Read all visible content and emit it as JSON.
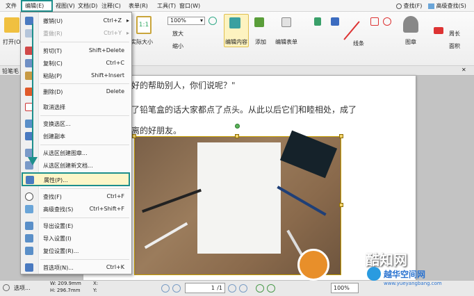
{
  "menubar": {
    "items": [
      "文件",
      "编辑(E)",
      "视图(V)",
      "文档(D)",
      "注释(C)",
      "表单(R)",
      "工具(T)",
      "窗口(W)"
    ],
    "right_find": "查找(F)",
    "right_adv_find": "高级查找(S)"
  },
  "ribbon": {
    "open": "打开(O)",
    "zoom": "100%",
    "actual_size": "实际大小",
    "zoom_in": "放大",
    "zoom_out": "缩小",
    "edit_content": "编辑内容",
    "add": "添加",
    "edit_form": "编辑表单",
    "lines": "线条",
    "stamp": "图章",
    "perimeter": "周长",
    "area": "面积",
    "subbar_left": "铅笔毛"
  },
  "doc": {
    "line1": "好的帮助别人，你们说呢？\"",
    "line2": "了铅笔盒的话大家都点了点头。从此以后它们和睦相处，成了",
    "line3": "离的好朋友。"
  },
  "edit_menu": {
    "items": [
      {
        "label": "撤销(U)",
        "shortcut": "Ctrl+Z",
        "arrow": "▸",
        "disabled": false,
        "icon": "undo-icon"
      },
      {
        "label": "重做(R)",
        "shortcut": "Ctrl+Y",
        "arrow": "▸",
        "disabled": true,
        "icon": "redo-icon"
      },
      {
        "label": "剪切(T)",
        "shortcut": "Shift+Delete",
        "disabled": false,
        "icon": "scissors-icon"
      },
      {
        "label": "复制(C)",
        "shortcut": "Ctrl+C",
        "disabled": false,
        "icon": "copy-icon"
      },
      {
        "label": "粘贴(P)",
        "shortcut": "Shift+Insert",
        "disabled": false,
        "icon": "paste-icon"
      },
      {
        "label": "删除(D)",
        "shortcut": "Delete",
        "disabled": false,
        "icon": "trash-icon"
      },
      {
        "label": "取消选择",
        "shortcut": "",
        "disabled": false,
        "icon": "deselect-icon"
      },
      {
        "label": "变换选区...",
        "shortcut": "",
        "disabled": false,
        "icon": "transform-icon"
      },
      {
        "label": "创建副本",
        "shortcut": "",
        "disabled": false,
        "icon": "duplicate-icon"
      },
      {
        "label": "从选区创建图章...",
        "shortcut": "",
        "disabled": false,
        "icon": "stamp-icon"
      },
      {
        "label": "从选区创建新文档...",
        "shortcut": "",
        "disabled": false,
        "icon": "new-doc-icon"
      },
      {
        "label": "属性(P)...",
        "shortcut": "",
        "disabled": false,
        "icon": "properties-icon"
      },
      {
        "label": "查找(F)",
        "shortcut": "Ctrl+F",
        "disabled": false,
        "icon": "find-icon"
      },
      {
        "label": "高级查找(S)",
        "shortcut": "Ctrl+Shift+F",
        "disabled": false,
        "icon": "advanced-find-icon"
      },
      {
        "label": "导出设置(E)",
        "shortcut": "",
        "disabled": false,
        "icon": "export-settings-icon"
      },
      {
        "label": "导入设置(I)",
        "shortcut": "",
        "disabled": false,
        "icon": "import-settings-icon"
      },
      {
        "label": "复位设置(R)...",
        "shortcut": "",
        "disabled": false,
        "icon": "reset-settings-icon"
      },
      {
        "label": "首选项(N)...",
        "shortcut": "Ctrl+K",
        "disabled": false,
        "icon": "preferences-icon"
      }
    ]
  },
  "status": {
    "options": "选项...",
    "width": "W: 209.9mm",
    "height": "H: 296.7mm",
    "x": "X:",
    "y": "Y:",
    "page": "1",
    "page_total": "/1",
    "zoom": "100%"
  },
  "watermark": {
    "brand": "酷知网",
    "site_name": "越华空间网",
    "site_url": "www.yueyangbang.com"
  },
  "colors": {
    "accent": "#1d8f8c",
    "highlight": "#fdf6c8"
  }
}
